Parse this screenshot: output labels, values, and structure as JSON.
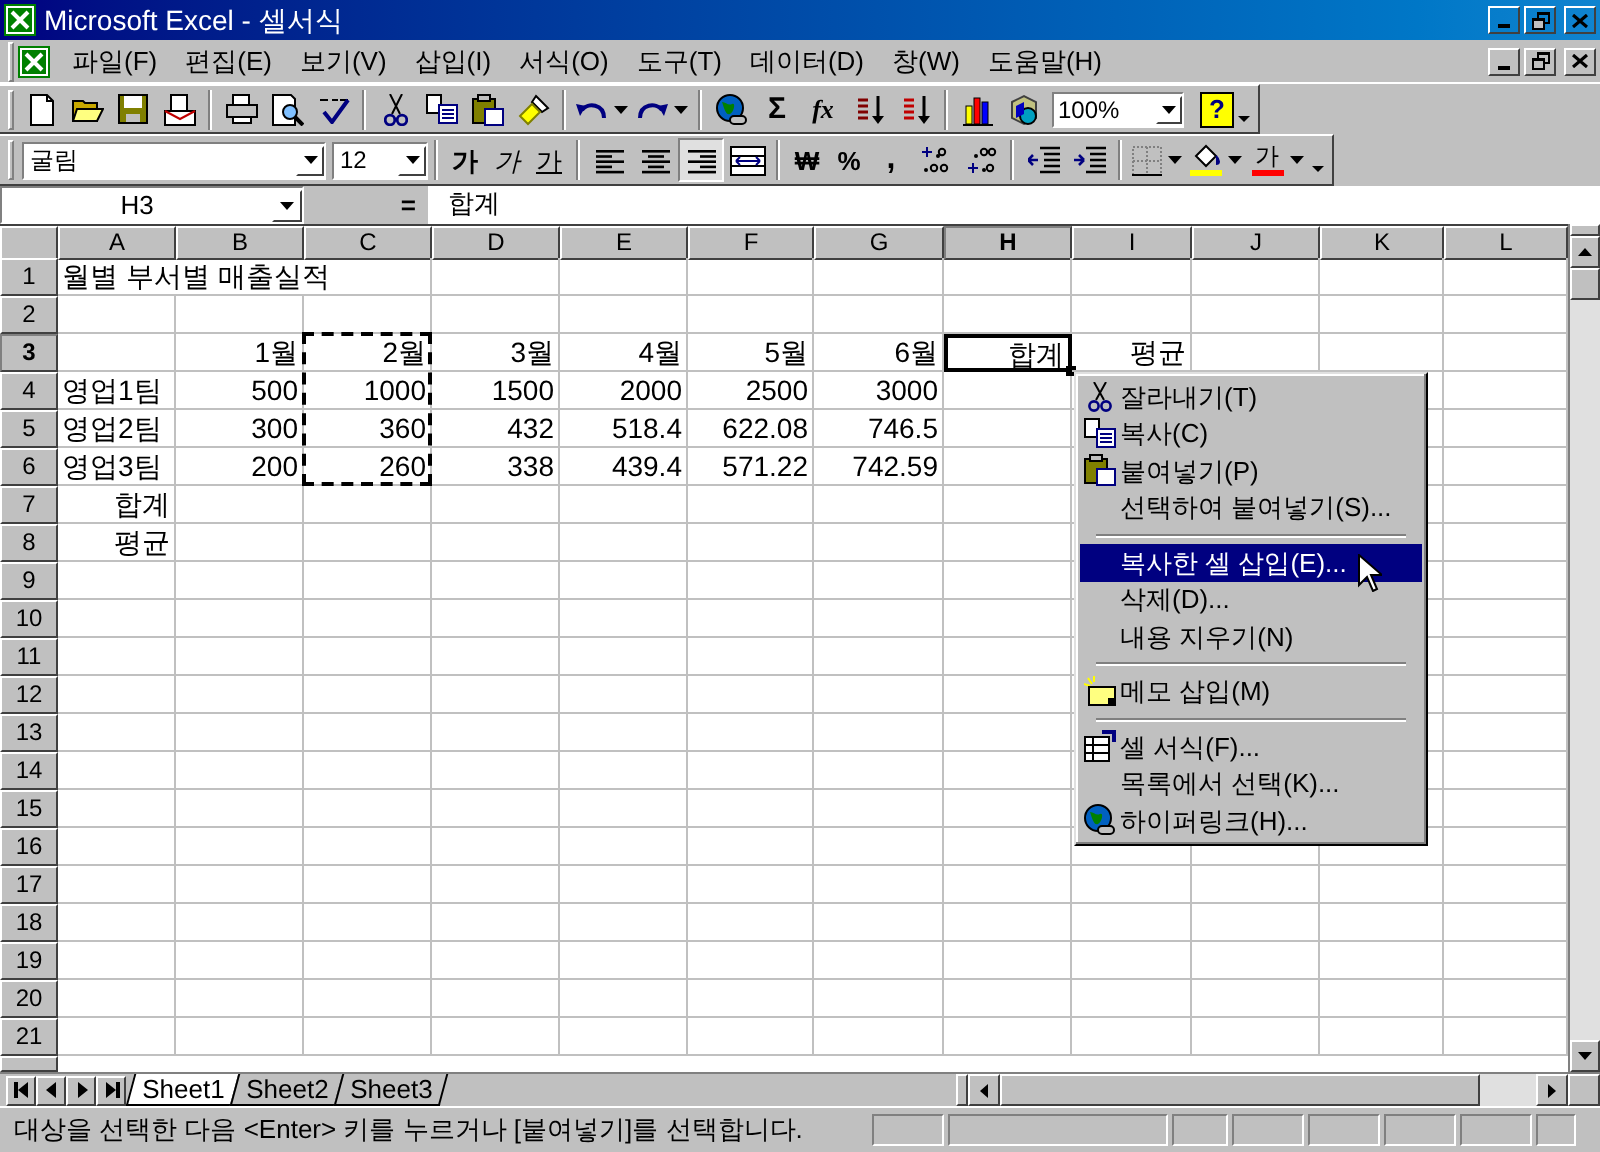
{
  "window": {
    "title": "Microsoft Excel - 셀서식"
  },
  "menu_bar": [
    "파일(F)",
    "편집(E)",
    "보기(V)",
    "삽입(I)",
    "서식(O)",
    "도구(T)",
    "데이터(D)",
    "창(W)",
    "도움말(H)"
  ],
  "standard_toolbar": {
    "sum_glyph": "Σ",
    "function_glyph": "fx",
    "zoom": "100%",
    "help_glyph": "?"
  },
  "formatting_toolbar": {
    "font": "굴림",
    "size": "12",
    "bold_glyph": "가",
    "italic_glyph": "가",
    "underline_glyph": "가",
    "alignment": [
      {
        "kind": "left",
        "selected": false
      },
      {
        "kind": "center",
        "selected": false
      },
      {
        "kind": "right",
        "selected": true
      }
    ],
    "currency_glyph": "₩",
    "percent_glyph": "%",
    "comma_glyph": ",",
    "font_color_glyph": "가"
  },
  "formula_bar": {
    "name_box": "H3",
    "equals": "=",
    "value": "합계"
  },
  "columns": [
    {
      "label": "A",
      "selected": false
    },
    {
      "label": "B",
      "selected": false
    },
    {
      "label": "C",
      "selected": false
    },
    {
      "label": "D",
      "selected": false
    },
    {
      "label": "E",
      "selected": false
    },
    {
      "label": "F",
      "selected": false
    },
    {
      "label": "G",
      "selected": false
    },
    {
      "label": "H",
      "selected": true
    },
    {
      "label": "I",
      "selected": false
    },
    {
      "label": "J",
      "selected": false
    },
    {
      "label": "K",
      "selected": false
    },
    {
      "label": "L",
      "selected": false
    }
  ],
  "rows": [
    {
      "number": "1",
      "selected": false,
      "cells": [
        {
          "text": "월별 부서별 매출실적",
          "kind": "label",
          "selected": false,
          "copied": false
        }
      ]
    },
    {
      "number": "2",
      "selected": false
    },
    {
      "number": "3",
      "selected": true,
      "cells": [
        null,
        {
          "text": "1월",
          "kind": "value",
          "selected": false,
          "copied": false
        },
        {
          "text": "2월",
          "kind": "value",
          "selected": false,
          "copied": true
        },
        {
          "text": "3월",
          "kind": "value",
          "selected": false,
          "copied": false
        },
        {
          "text": "4월",
          "kind": "value",
          "selected": false,
          "copied": false
        },
        {
          "text": "5월",
          "kind": "value",
          "selected": false,
          "copied": false
        },
        {
          "text": "6월",
          "kind": "value",
          "selected": false,
          "copied": false
        },
        {
          "text": "합계",
          "kind": "value",
          "selected": true,
          "copied": false
        },
        {
          "text": "평균",
          "kind": "value",
          "selected": false,
          "copied": false
        }
      ]
    },
    {
      "number": "4",
      "selected": false,
      "cells": [
        {
          "text": "영업1팀",
          "kind": "label",
          "selected": false,
          "copied": false
        },
        {
          "text": "500",
          "kind": "value",
          "selected": false,
          "copied": false
        },
        {
          "text": "1000",
          "kind": "value",
          "selected": false,
          "copied": true
        },
        {
          "text": "1500",
          "kind": "value",
          "selected": false,
          "copied": false
        },
        {
          "text": "2000",
          "kind": "value",
          "selected": false,
          "copied": false
        },
        {
          "text": "2500",
          "kind": "value",
          "selected": false,
          "copied": false
        },
        {
          "text": "3000",
          "kind": "value",
          "selected": false,
          "copied": false
        }
      ]
    },
    {
      "number": "5",
      "selected": false,
      "cells": [
        {
          "text": "영업2팀",
          "kind": "label",
          "selected": false,
          "copied": false
        },
        {
          "text": "300",
          "kind": "value",
          "selected": false,
          "copied": false
        },
        {
          "text": "360",
          "kind": "value",
          "selected": false,
          "copied": true
        },
        {
          "text": "432",
          "kind": "value",
          "selected": false,
          "copied": false
        },
        {
          "text": "518.4",
          "kind": "value",
          "selected": false,
          "copied": false
        },
        {
          "text": "622.08",
          "kind": "value",
          "selected": false,
          "copied": false
        },
        {
          "text": "746.5",
          "kind": "value",
          "selected": false,
          "copied": false
        }
      ]
    },
    {
      "number": "6",
      "selected": false,
      "cells": [
        {
          "text": "영업3팀",
          "kind": "label",
          "selected": false,
          "copied": false
        },
        {
          "text": "200",
          "kind": "value",
          "selected": false,
          "copied": false
        },
        {
          "text": "260",
          "kind": "value",
          "selected": false,
          "copied": true
        },
        {
          "text": "338",
          "kind": "value",
          "selected": false,
          "copied": false
        },
        {
          "text": "439.4",
          "kind": "value",
          "selected": false,
          "copied": false
        },
        {
          "text": "571.22",
          "kind": "value",
          "selected": false,
          "copied": false
        },
        {
          "text": "742.59",
          "kind": "value",
          "selected": false,
          "copied": false
        }
      ]
    },
    {
      "number": "7",
      "selected": false,
      "cells": [
        {
          "text": "합계",
          "kind": "value",
          "selected": false,
          "copied": false
        }
      ]
    },
    {
      "number": "8",
      "selected": false,
      "cells": [
        {
          "text": "평균",
          "kind": "value",
          "selected": false,
          "copied": false
        }
      ]
    },
    {
      "number": "9",
      "selected": false
    },
    {
      "number": "10",
      "selected": false
    },
    {
      "number": "11",
      "selected": false
    },
    {
      "number": "12",
      "selected": false
    },
    {
      "number": "13",
      "selected": false
    },
    {
      "number": "14",
      "selected": false
    },
    {
      "number": "15",
      "selected": false
    },
    {
      "number": "16",
      "selected": false
    },
    {
      "number": "17",
      "selected": false
    },
    {
      "number": "18",
      "selected": false
    },
    {
      "number": "19",
      "selected": false
    },
    {
      "number": "20",
      "selected": false
    },
    {
      "number": "21",
      "selected": false
    }
  ],
  "context_menu": [
    {
      "kind": "item",
      "label": "잘라내기(T)",
      "selected": false
    },
    {
      "kind": "item",
      "label": "복사(C)",
      "selected": false
    },
    {
      "kind": "item",
      "label": "붙여넣기(P)",
      "selected": false
    },
    {
      "kind": "item",
      "label": "선택하여 붙여넣기(S)...",
      "selected": false
    },
    {
      "kind": "separator"
    },
    {
      "kind": "item",
      "label": "복사한 셀 삽입(E)...",
      "selected": true
    },
    {
      "kind": "item",
      "label": "삭제(D)...",
      "selected": false
    },
    {
      "kind": "item",
      "label": "내용 지우기(N)",
      "selected": false
    },
    {
      "kind": "separator"
    },
    {
      "kind": "item",
      "label": "메모 삽입(M)",
      "selected": false
    },
    {
      "kind": "separator"
    },
    {
      "kind": "item",
      "label": "셀 서식(F)...",
      "selected": false
    },
    {
      "kind": "item",
      "label": "목록에서 선택(K)...",
      "selected": false
    },
    {
      "kind": "item",
      "label": "하이퍼링크(H)...",
      "selected": false
    }
  ],
  "sheet_tabs": [
    {
      "label": "Sheet1",
      "selected": true
    },
    {
      "label": "Sheet2",
      "selected": false
    },
    {
      "label": "Sheet3",
      "selected": false
    }
  ],
  "status_bar": "대상을 선택한 다음 <Enter> 키를 누르거나 [붙여넣기]를 선택합니다."
}
